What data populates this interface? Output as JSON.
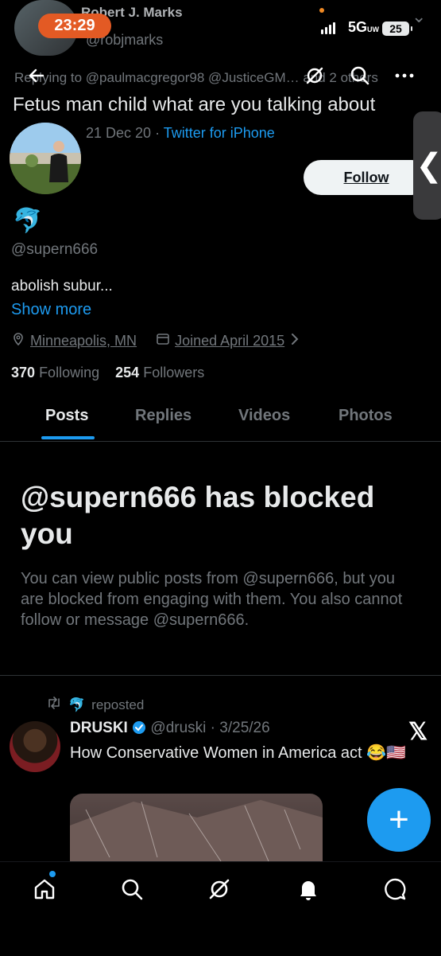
{
  "status_bar": {
    "time": "23:29",
    "network": "5G",
    "network_sub": "UW",
    "battery": "25"
  },
  "background_tweet": {
    "author_name": "Robert J. Marks",
    "author_handle": "@robjmarks",
    "reply_to": "Replying to @paulmacgregor98 @JusticeGM… and 2 others",
    "text": "Fetus man child what are you talking about",
    "date": "21 Dec 20",
    "client": "Twitter for iPhone"
  },
  "profile": {
    "display_name_emoji": "🐬",
    "handle": "@supern666",
    "bio": "abolish subur...",
    "show_more": "Show more",
    "location": "Minneapolis, MN",
    "joined": "Joined April 2015",
    "following_count": "370",
    "following_label": "Following",
    "followers_count": "254",
    "followers_label": "Followers",
    "follow_button": "Follow"
  },
  "tabs": [
    "Posts",
    "Replies",
    "Videos",
    "Photos"
  ],
  "blocked": {
    "title": "@supern666 has blocked you",
    "body": "You can view public posts from @supern666, but you are blocked from engaging with them. You also cannot follow or message @supern666."
  },
  "post": {
    "repost_label": "reposted",
    "repost_emoji": "🐬",
    "author_name": "DRUSKI",
    "author_handle": "@druski",
    "date": "3/25/26",
    "text": "How Conservative Women in America act 😂🇺🇸"
  },
  "fab_label": "+",
  "colors": {
    "accent": "#1d9bf0",
    "background": "#000000",
    "muted": "#71767b",
    "time_pill": "#e35a24"
  },
  "icons": [
    "back-arrow-icon",
    "grok-icon",
    "search-icon",
    "more-icon",
    "home-icon",
    "explore-icon",
    "notifications-icon",
    "messages-icon"
  ]
}
